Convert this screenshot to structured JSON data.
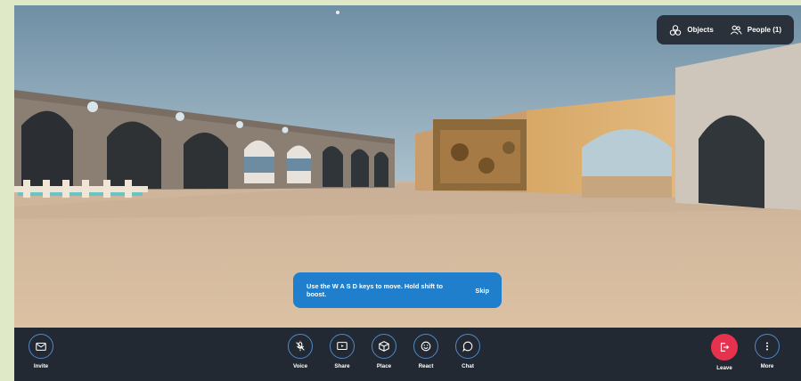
{
  "top_bar": {
    "objects_label": "Objects",
    "people_label": "People (1)"
  },
  "hint": {
    "text": "Use the W A S D keys to move. Hold shift to boost.",
    "skip_label": "Skip"
  },
  "toolbar": {
    "invite_label": "Invite",
    "voice_label": "Voice",
    "share_label": "Share",
    "place_label": "Place",
    "react_label": "React",
    "chat_label": "Chat",
    "leave_label": "Leave",
    "more_label": "More"
  },
  "icons": {
    "objects": "objects-icon",
    "people": "people-icon",
    "invite": "envelope-icon",
    "voice": "microphone-muted-icon",
    "share": "screen-share-icon",
    "place": "cube-icon",
    "react": "smiley-icon",
    "chat": "chat-bubble-icon",
    "leave": "exit-icon",
    "more": "vertical-dots-icon"
  },
  "colors": {
    "accent": "#4d87c7",
    "toolbar_bg": "#232933",
    "hint_bg": "#1f7fcc",
    "leave": "#e7324f"
  }
}
